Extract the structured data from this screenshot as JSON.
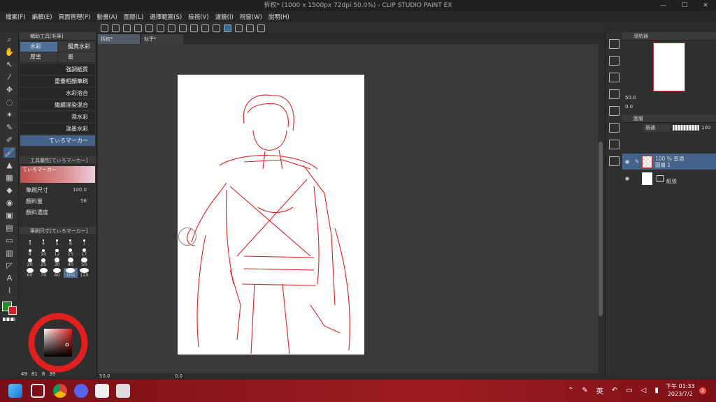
{
  "window": {
    "title": "拆权* (1000 x 1500px 72dpi 50.0%) - CLIP STUDIO PAINT EX",
    "minimize": "—",
    "maximize": "☐",
    "close": "✕"
  },
  "menu": [
    "檔案(F)",
    "編輯(E)",
    "頁面管理(P)",
    "動畫(A)",
    "圖層(L)",
    "選擇範圍(S)",
    "檢視(V)",
    "濾鏡(I)",
    "視窗(W)",
    "說明(H)"
  ],
  "subtool": {
    "title": "輔助工具[毛筆]",
    "groups": [
      "水彩",
      "擬真水彩",
      "厚塗",
      "墨"
    ],
    "brushes": [
      "強調紙質",
      "重疊相顏筆刷",
      "水彩溶合",
      "繼續混染混合",
      "濕水彩",
      "混墨水彩",
      "てぃろマーカー"
    ]
  },
  "toolprop": {
    "title": "工具屬性[てぃろマーカー]",
    "preview_label": "てぃろマーカー",
    "rows": [
      {
        "label": "筆刷尺寸",
        "value": "100.0"
      },
      {
        "label": "顏料量",
        "value": "58"
      },
      {
        "label": "顏料濃度",
        "value": ""
      }
    ]
  },
  "brushsize": {
    "title": "筆刷尺寸[てぃろマーカー]",
    "sizes": [
      "3",
      "4",
      "5",
      "6",
      "7",
      "8",
      "10",
      "12",
      "15",
      "17",
      "20",
      "25",
      "30",
      "40",
      "50",
      "60",
      "70",
      "80",
      "100",
      "120"
    ]
  },
  "color": {
    "main": "#2b8a2b",
    "sub": "#d42020",
    "readout": [
      "49",
      "81",
      "8",
      "39"
    ]
  },
  "doc_tabs": [
    "拆权*",
    "似乎*"
  ],
  "status": {
    "zoom": "50.0",
    "angle": "0.0"
  },
  "navigator": {
    "title": "導航器",
    "zoom": "50.0",
    "angle": "0.0"
  },
  "layers": {
    "title": "圖層",
    "blend_mode": "普通",
    "opacity": "100",
    "items": [
      {
        "meta": "100 % 普通",
        "name": "圖層 1"
      },
      {
        "meta": "",
        "name": "紙張"
      }
    ]
  },
  "taskbar": {
    "ime": "英",
    "time": "下午 01:33",
    "date": "2023/7/2",
    "notify": "2"
  },
  "accent": "#4e6f96",
  "sketch_color": "#e02020"
}
